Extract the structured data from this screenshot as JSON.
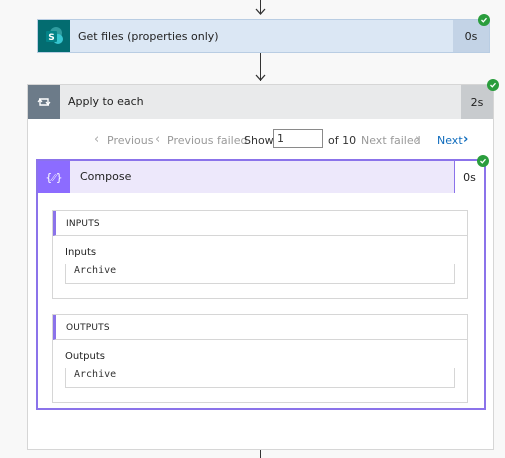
{
  "get_files": {
    "title": "Get files (properties only)",
    "duration": "0s",
    "icon": "sharepoint-icon",
    "color": "#036c70"
  },
  "apply_to_each": {
    "title": "Apply to each",
    "duration": "2s",
    "icon": "loop-icon"
  },
  "pagination": {
    "previous": "Previous",
    "previous_failed": "Previous failed",
    "show": "Show",
    "current": "1",
    "of_total": "of 10",
    "next_failed": "Next failed",
    "next": "Next"
  },
  "compose": {
    "title": "Compose",
    "duration": "0s",
    "icon_glyph": "{⁄⁄}",
    "accent": "#8b73ea",
    "inputs": {
      "header": "INPUTS",
      "label": "Inputs",
      "value": "Archive"
    },
    "outputs": {
      "header": "OUTPUTS",
      "label": "Outputs",
      "value": "Archive"
    }
  },
  "status_color": "#2a9d3d",
  "link_color": "#0f6cbd"
}
